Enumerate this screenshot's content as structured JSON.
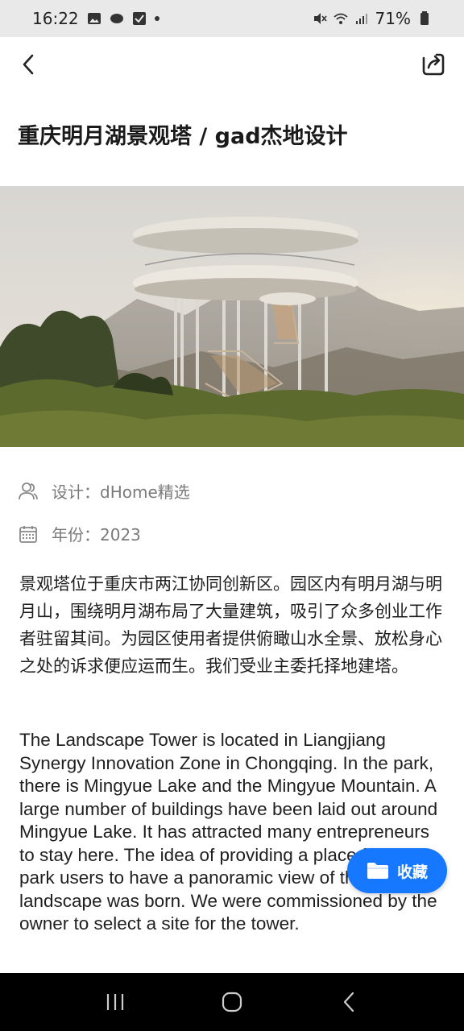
{
  "status_bar": {
    "time": "16:22",
    "battery": "71%"
  },
  "article": {
    "title": "重庆明月湖景观塔 / gad杰地设计",
    "designer": "设计：dHome精选",
    "year": "年份：2023",
    "para_cn": "景观塔位于重庆市两江协同创新区。园区内有明月湖与明月山，围绕明月湖布局了大量建筑，吸引了众多创业工作者驻留其间。为园区使用者提供俯瞰山水全景、放松身心之处的诉求便应运而生。我们受业主委托择地建塔。",
    "para_en": "The Landscape Tower is located in Liangjiang Synergy Innovation Zone in Chongqing. In the park, there is Mingyue Lake and the Mingyue Mountain. A large number of buildings have been laid out around Mingyue Lake. It has attracted many entrepreneurs to stay here. The idea of providing a place for the park users to have a panoramic view of the landscape was born. We were commissioned by the owner to select a site for the tower."
  },
  "fav_button": {
    "label": "收藏"
  },
  "colors": {
    "accent": "#1677ff",
    "status_bar_bg": "#e9e9e9",
    "nav_bar_bg": "#000000"
  },
  "icons": {
    "back": "chevron-left-icon",
    "share": "share-icon",
    "designer": "user-group-icon",
    "year": "calendar-icon",
    "fav": "folder-icon",
    "nav_recent": "recent-apps-icon",
    "nav_home": "home-icon",
    "nav_back": "nav-back-icon"
  }
}
